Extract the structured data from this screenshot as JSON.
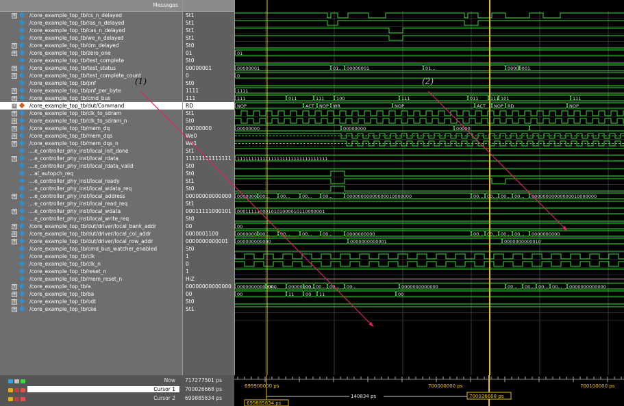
{
  "header": {
    "messages": "Messages"
  },
  "signals": [
    {
      "name": "/core_example_top_tb/cs_n_delayed",
      "value": "St1",
      "expander": true,
      "color": "#2f8fd0"
    },
    {
      "name": "/core_example_top_tb/ras_n_delayed",
      "value": "St1",
      "expander": false,
      "color": "#2f8fd0"
    },
    {
      "name": "/core_example_top_tb/cas_n_delayed",
      "value": "St1",
      "expander": false,
      "color": "#2f8fd0"
    },
    {
      "name": "/core_example_top_tb/we_n_delayed",
      "value": "St1",
      "expander": false,
      "color": "#2f8fd0"
    },
    {
      "name": "/core_example_top_tb/dm_delayed",
      "value": "St0",
      "expander": true,
      "color": "#2f8fd0"
    },
    {
      "name": "/core_example_top_tb/zero_one",
      "value": "01",
      "expander": true,
      "color": "#2f8fd0"
    },
    {
      "name": "/core_example_top_tb/test_complete",
      "value": "St0",
      "expander": false,
      "color": "#2f8fd0"
    },
    {
      "name": "/core_example_top_tb/test_status",
      "value": "00000001",
      "expander": true,
      "color": "#2f8fd0"
    },
    {
      "name": "/core_example_top_tb/test_complete_count",
      "value": "0",
      "expander": true,
      "color": "#2f8fd0"
    },
    {
      "name": "/core_example_top_tb/pnf",
      "value": "St0",
      "expander": false,
      "color": "#2f8fd0"
    },
    {
      "name": "/core_example_top_tb/pnf_per_byte",
      "value": "1111",
      "expander": true,
      "color": "#2f8fd0"
    },
    {
      "name": "/core_example_top_tb/cmd_bus",
      "value": "111",
      "expander": true,
      "color": "#2f8fd0"
    },
    {
      "name": "/core_example_top_tb/dut/Command",
      "value": "RD",
      "expander": true,
      "color": "#d06020"
    },
    {
      "name": "/core_example_top_tb/clk_to_sdram",
      "value": "St1",
      "expander": true,
      "color": "#2f8fd0"
    },
    {
      "name": "/core_example_top_tb/clk_to_sdram_n",
      "value": "St0",
      "expander": true,
      "color": "#2f8fd0"
    },
    {
      "name": "/core_example_top_tb/mem_dq",
      "value": "00000000",
      "expander": true,
      "color": "#2f8fd0"
    },
    {
      "name": "/core_example_top_tb/mem_dqs",
      "value": "We0",
      "expander": true,
      "color": "#2f8fd0"
    },
    {
      "name": "/core_example_top_tb/mem_dqs_n",
      "value": "We1",
      "expander": true,
      "color": "#2f8fd0"
    },
    {
      "name": "...e_controller_phy_inst/local_init_done",
      "value": "St1",
      "expander": false,
      "color": "#2f8fd0"
    },
    {
      "name": "...e_controller_phy_inst/local_rdata",
      "value": "11111111111111",
      "expander": true,
      "color": "#2f8fd0"
    },
    {
      "name": "...e_controller_phy_inst/local_rdata_valid",
      "value": "St0",
      "expander": false,
      "color": "#2f8fd0"
    },
    {
      "name": "...al_autopch_req",
      "value": "St0",
      "expander": false,
      "color": "#2f8fd0"
    },
    {
      "name": "...e_controller_phy_inst/local_ready",
      "value": "St1",
      "expander": false,
      "color": "#2f8fd0"
    },
    {
      "name": "...e_controller_phy_inst/local_wdata_req",
      "value": "St0",
      "expander": false,
      "color": "#2f8fd0"
    },
    {
      "name": "...e_controller_phy_inst/local_address",
      "value": "00000000000000",
      "expander": true,
      "color": "#2f8fd0"
    },
    {
      "name": "...e_controller_phy_inst/local_read_req",
      "value": "St1",
      "expander": false,
      "color": "#2f8fd0"
    },
    {
      "name": "...e_controller_phy_inst/local_wdata",
      "value": "00011111000101",
      "expander": true,
      "color": "#2f8fd0"
    },
    {
      "name": "...e_controller_phy_inst/local_write_req",
      "value": "St0",
      "expander": false,
      "color": "#2f8fd0"
    },
    {
      "name": "/core_example_top_tb/dut/driver/local_bank_addr",
      "value": "00",
      "expander": true,
      "color": "#2f8fd0"
    },
    {
      "name": "/core_example_top_tb/dut/driver/local_col_addr",
      "value": "0000001100",
      "expander": true,
      "color": "#2f8fd0"
    },
    {
      "name": "/core_example_top_tb/dut/driver/local_row_addr",
      "value": "0000000000001",
      "expander": true,
      "color": "#2f8fd0"
    },
    {
      "name": "/core_example_top_tb/cmd_bus_watcher_enabled",
      "value": "St0",
      "expander": false,
      "color": "#2f8fd0"
    },
    {
      "name": "/core_example_top_tb/clk",
      "value": "1",
      "expander": false,
      "color": "#2f8fd0"
    },
    {
      "name": "/core_example_top_tb/clk_n",
      "value": "0",
      "expander": false,
      "color": "#2f8fd0"
    },
    {
      "name": "/core_example_top_tb/reset_n",
      "value": "1",
      "expander": false,
      "color": "#2f8fd0"
    },
    {
      "name": "/core_example_top_tb/mem_reset_n",
      "value": "HiZ",
      "expander": false,
      "color": "#2f8fd0"
    },
    {
      "name": "/core_example_top_tb/a",
      "value": "00000000000000",
      "expander": true,
      "color": "#2f8fd0"
    },
    {
      "name": "/core_example_top_tb/ba",
      "value": "00",
      "expander": true,
      "color": "#2f8fd0"
    },
    {
      "name": "/core_example_top_tb/odt",
      "value": "St0",
      "expander": true,
      "color": "#2f8fd0"
    },
    {
      "name": "/core_example_top_tb/cke",
      "value": "St1",
      "expander": true,
      "color": "#2f8fd0"
    }
  ],
  "bus_labels": {
    "zero_one": [
      "01"
    ],
    "test_status": [
      "00000001",
      "01...",
      "00000001",
      "01...",
      "00000001"
    ],
    "test_complete_count": [
      "0"
    ],
    "pnf_per_byte": [
      "1111"
    ],
    "cmd_bus": [
      "111",
      "011",
      "111",
      "100",
      "111",
      "011",
      "111",
      "101",
      "111"
    ],
    "command": [
      "NOP",
      "ACT",
      "NOP",
      "WR",
      "NOP",
      "ACT",
      "NOP",
      "RD",
      "NOP"
    ],
    "mem_dq": [
      "00000000",
      "00000000",
      "00000"
    ],
    "local_rdata": [
      "11111111111111111111111111111111"
    ],
    "local_address": [
      "00000000",
      "00...",
      "00...",
      "00...",
      "00...",
      "00000000000000010000000",
      "00...",
      "00...",
      "00...",
      "00...",
      "00000000000000010000000"
    ],
    "local_wdata": [
      "0001111100010101000010110000001"
    ],
    "local_bank_addr": [
      "00"
    ],
    "local_col_addr": [
      "00000000",
      "00...",
      "00...",
      "00...",
      "00...",
      "0000000000",
      "00...",
      "00...",
      "00...",
      "00...",
      "0000000000"
    ],
    "local_row_addr": [
      "000000000000",
      "0000000000001",
      "0000000000010"
    ],
    "a": [
      "00000000000000",
      "00...",
      "00000000...",
      "00...",
      "00...",
      "00...",
      "00...",
      "0000000000000",
      "00...",
      "00...",
      "00...",
      "00...",
      "0000000000000"
    ],
    "ba": [
      "00",
      "11",
      "00",
      "11",
      "00"
    ]
  },
  "annotations": [
    "(1)",
    "(2)"
  ],
  "bottom": {
    "now_label": "Now",
    "now_value": "717277501 ps",
    "cursor1_label": "Cursor 1",
    "cursor1_value": "700026668 ps",
    "cursor2_label": "Cursor 2",
    "cursor2_value": "699885834 ps",
    "tick_labels": [
      "699900000 ps",
      "700000000 ps",
      "700100000 ps"
    ],
    "delta": "140834 ps",
    "cursor1_flag": "700026668 ps",
    "cursor2_flag": "699885834 ps"
  },
  "colors": {
    "wave": "#3ddc3d",
    "cursor": "#e8c020",
    "arrow": "#e0206a",
    "bus_text": "#e8e8e8",
    "grid": "#3a3a3a"
  }
}
